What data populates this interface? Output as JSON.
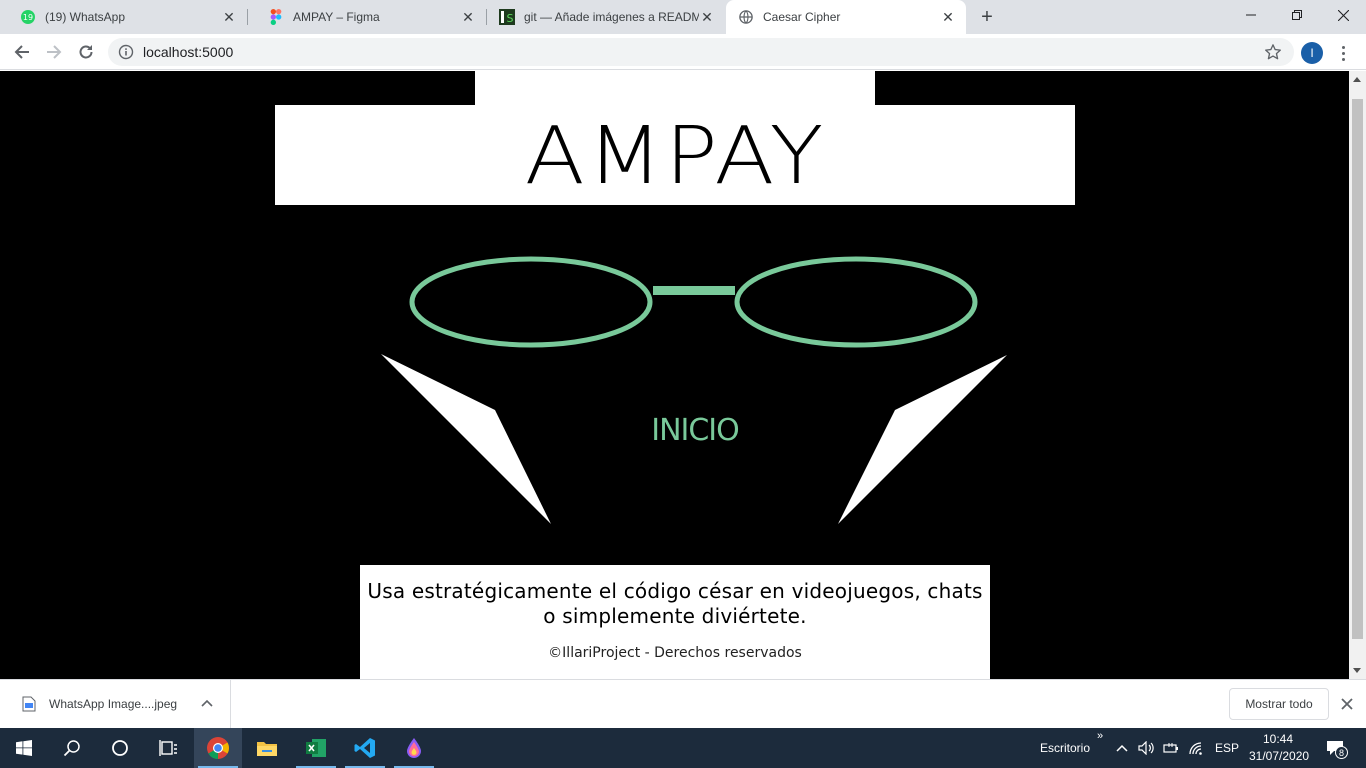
{
  "browser": {
    "tabs": [
      {
        "title": "(19) WhatsApp",
        "favicon": "whatsapp-icon",
        "badge": "19"
      },
      {
        "title": "AMPAY – Figma",
        "favicon": "figma-icon"
      },
      {
        "title": "git — Añade imágenes a README",
        "favicon": "git-icon"
      },
      {
        "title": "Caesar Cipher",
        "favicon": "globe-icon"
      }
    ],
    "active_tab": 3,
    "url": "localhost:5000",
    "profile_initial": "I"
  },
  "page": {
    "logo": "AMPAY",
    "inicio_label": "INICIO",
    "tagline": "Usa estratégicamente el código césar en videojuegos, chats o simplemente diviértete.",
    "copyright": "©IllariProject - Derechos reservados",
    "colors": {
      "accent": "#79c99a",
      "background": "#000000",
      "panel": "#ffffff"
    }
  },
  "downloads": {
    "file_name": "WhatsApp Image....jpeg",
    "show_all_label": "Mostrar todo"
  },
  "taskbar": {
    "apps": [
      "windows-start-icon",
      "search-icon",
      "cortana-icon",
      "task-view-icon",
      "chrome-icon",
      "file-explorer-icon",
      "excel-icon",
      "vscode-icon",
      "inkdrop-icon"
    ],
    "desktop_label": "Escritorio",
    "language": "ESP",
    "time": "10:44",
    "date": "31/07/2020",
    "notifications": "8"
  }
}
